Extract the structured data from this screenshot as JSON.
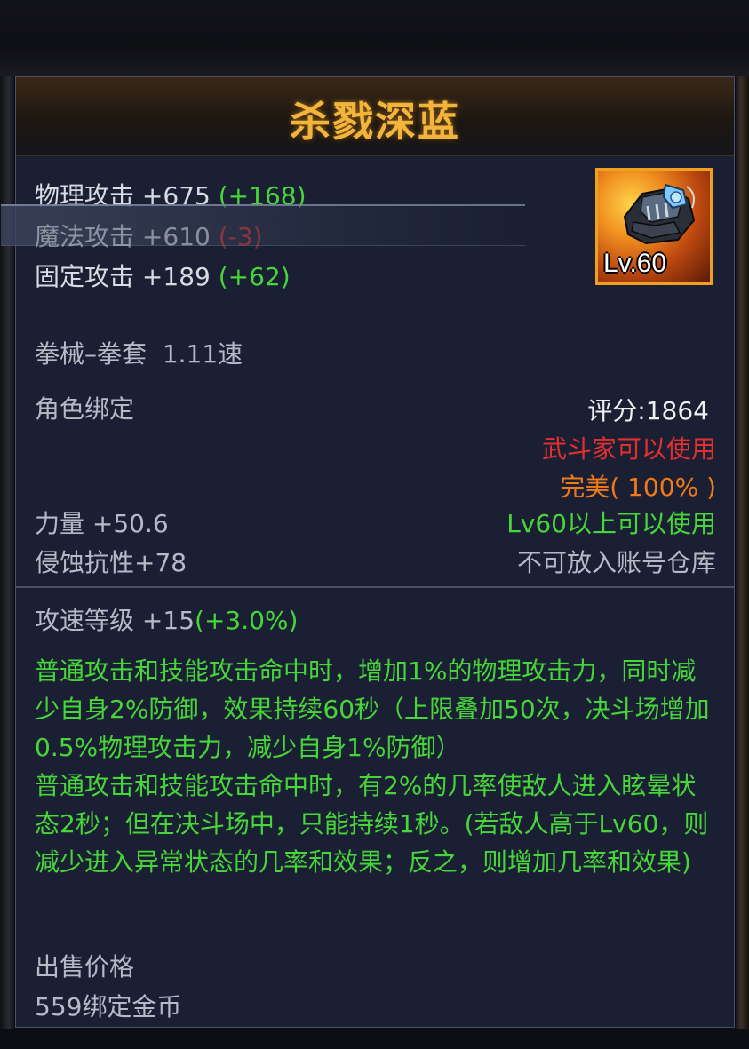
{
  "item": {
    "name": "杀戮深蓝",
    "level_badge": "Lv.60"
  },
  "stats": {
    "physical": {
      "label": "物理攻击",
      "value": "+675",
      "bonus": "(+168)"
    },
    "magic": {
      "label": "魔法攻击",
      "value": "+610",
      "bonus": "(-3)"
    },
    "fixed": {
      "label": "固定攻击",
      "value": "+189",
      "bonus": "(+62)"
    }
  },
  "weapon_type": "拳械–拳套",
  "speed": "1.11速",
  "bind": "角色绑定",
  "score": "评分:1864",
  "usable_class": "武斗家可以使用",
  "quality": "完美( 100% )",
  "level_req": "Lv60以上可以使用",
  "no_account_storage": "不可放入账号仓库",
  "strength": "力量 +50.6",
  "erosion_resist": "侵蚀抗性+78",
  "atk_speed": {
    "label": "攻速等级",
    "value": "+15",
    "bonus": "(+3.0%)"
  },
  "description": "普通攻击和技能攻击命中时，增加1%的物理攻击力，同时减少自身2%防御，效果持续60秒（上限叠加50次，决斗场增加0.5%物理攻击力，减少自身1%防御）\n普通攻击和技能攻击命中时，有2%的几率使敌人进入眩晕状态2秒；但在决斗场中，只能持续1秒。(若敌人高于Lv60，则减少进入异常状态的几率和效果；反之，则增加几率和效果)",
  "sell": {
    "label": "出售价格",
    "price": "559绑定金币"
  },
  "colors": {
    "title": "#f2b43a",
    "green": "#47d63a",
    "red": "#e23030",
    "orange": "#f07a18",
    "panel": "#1a1f33"
  },
  "icon": "gauntlet-icon"
}
